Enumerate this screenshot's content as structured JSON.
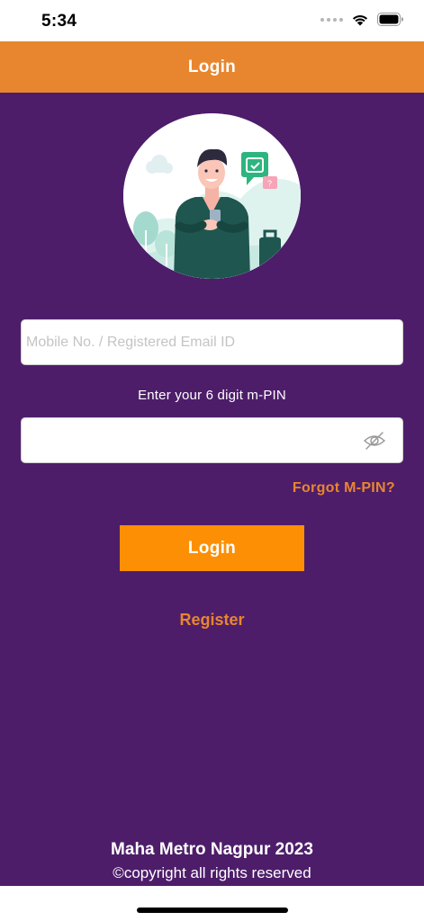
{
  "status_bar": {
    "time": "5:34",
    "icons": [
      "signal-dots-icon",
      "wifi-icon",
      "battery-icon"
    ]
  },
  "header": {
    "title": "Login",
    "background_color": "#e8862f"
  },
  "theme": {
    "main_background": "#4d1d6a",
    "accent": "#e8862f",
    "button_color": "#fd8f04"
  },
  "form": {
    "mobile_placeholder": "Mobile No. / Registered Email ID",
    "mobile_value": "",
    "pin_label": "Enter your 6 digit m-PIN",
    "pin_value": "",
    "pin_visibility_icon": "eye-slash-icon",
    "forgot_label": "Forgot M-PIN?",
    "login_label": "Login",
    "register_label": "Register"
  },
  "footer": {
    "title": "Maha Metro Nagpur 2023",
    "copyright": "©copyright all rights reserved"
  }
}
